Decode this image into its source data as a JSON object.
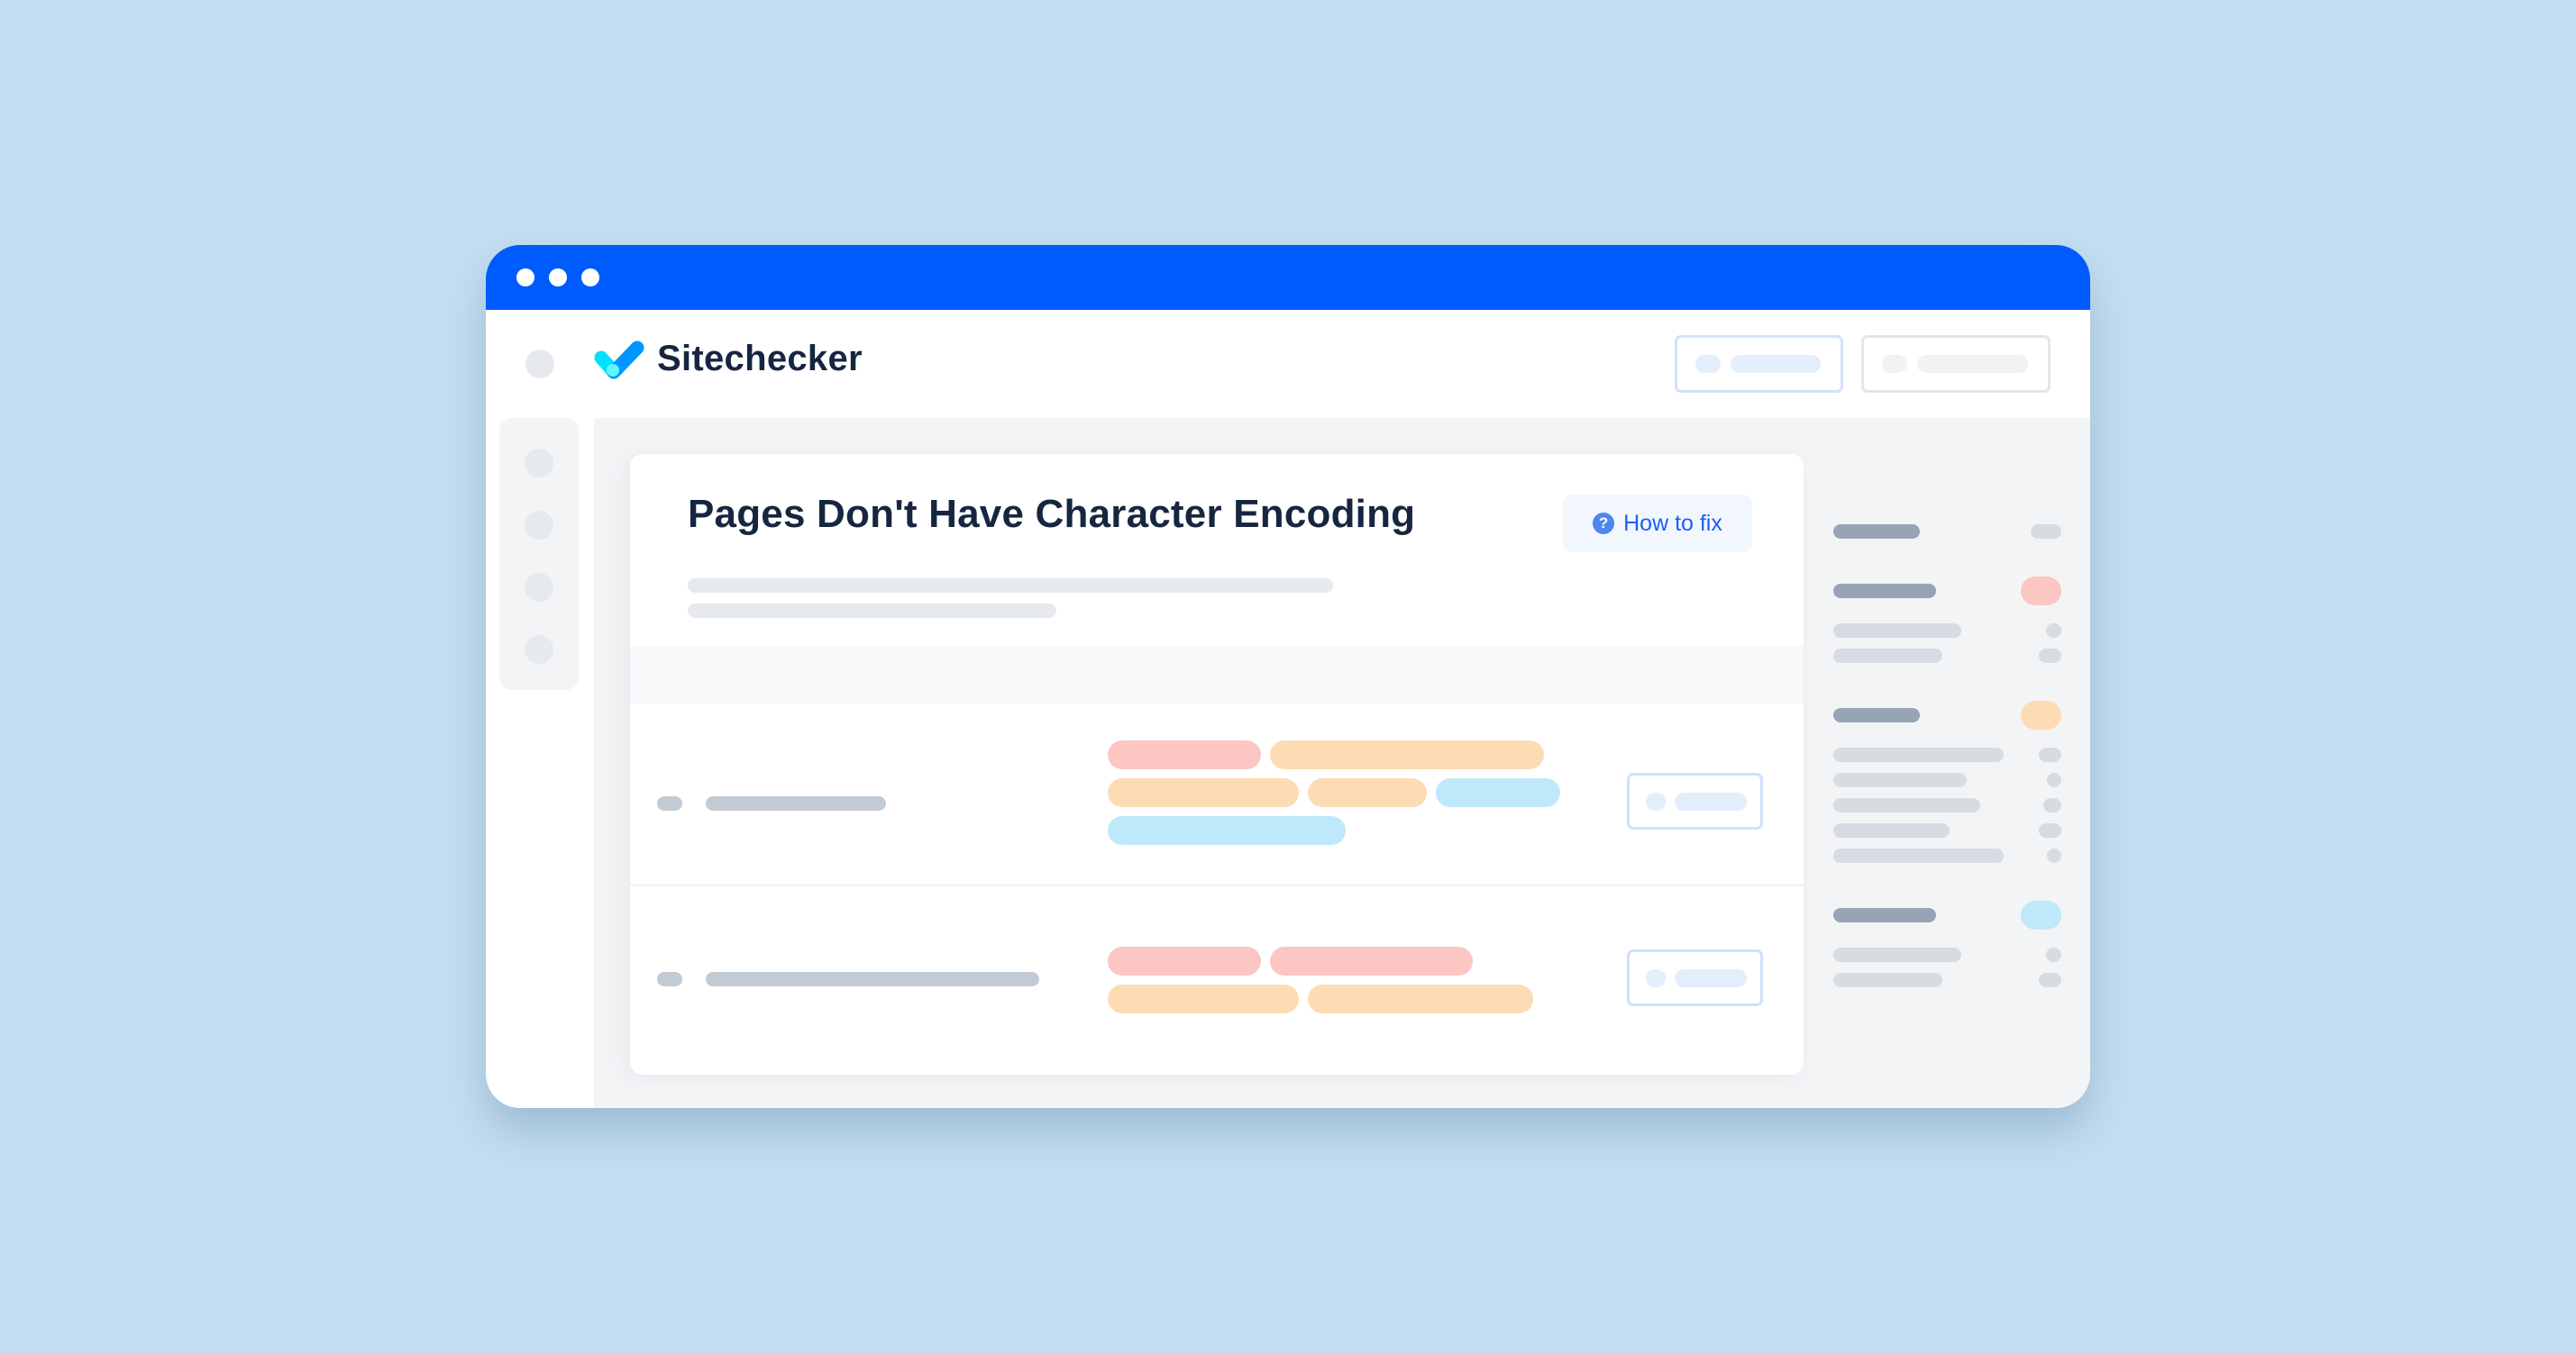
{
  "window": {
    "titlebar_color": "#005bff",
    "window_controls": [
      "dot",
      "dot",
      "dot"
    ]
  },
  "header": {
    "brand": "Sitechecker",
    "logo_icon": "check-logo-icon",
    "buttons": [
      {
        "name": "primary-header-button",
        "style": "blue-outline"
      },
      {
        "name": "secondary-header-button",
        "style": "grey-outline"
      }
    ]
  },
  "sidebar": {
    "items": [
      {
        "icon": "nav-dot-icon"
      },
      {
        "icon": "nav-dot-icon"
      },
      {
        "icon": "nav-dot-icon"
      },
      {
        "icon": "nav-dot-icon"
      }
    ]
  },
  "issue": {
    "title": "Pages Don't Have Character Encoding",
    "how_to_fix_label": "How to fix",
    "how_to_fix_icon": "?",
    "accent_color": "#1b60f2"
  },
  "table": {
    "rows": [
      {
        "tags": [
          {
            "color": "pink"
          },
          {
            "color": "orange"
          },
          {
            "color": "orange"
          },
          {
            "color": "orange"
          },
          {
            "color": "blue"
          },
          {
            "color": "blue"
          }
        ]
      },
      {
        "tags": [
          {
            "color": "pink"
          },
          {
            "color": "pink"
          },
          {
            "color": "orange"
          },
          {
            "color": "orange"
          }
        ]
      }
    ]
  },
  "side_panel": {
    "groups": [
      {
        "badge": "none",
        "lines": 0
      },
      {
        "badge": "pink",
        "lines": 2
      },
      {
        "badge": "orange",
        "lines": 5
      },
      {
        "badge": "blue",
        "lines": 2
      }
    ]
  },
  "colors": {
    "pink": "#fcc6c3",
    "orange": "#fddcb3",
    "blue": "#c0e8fb",
    "background": "#c3def0",
    "text_dark": "#172640"
  }
}
